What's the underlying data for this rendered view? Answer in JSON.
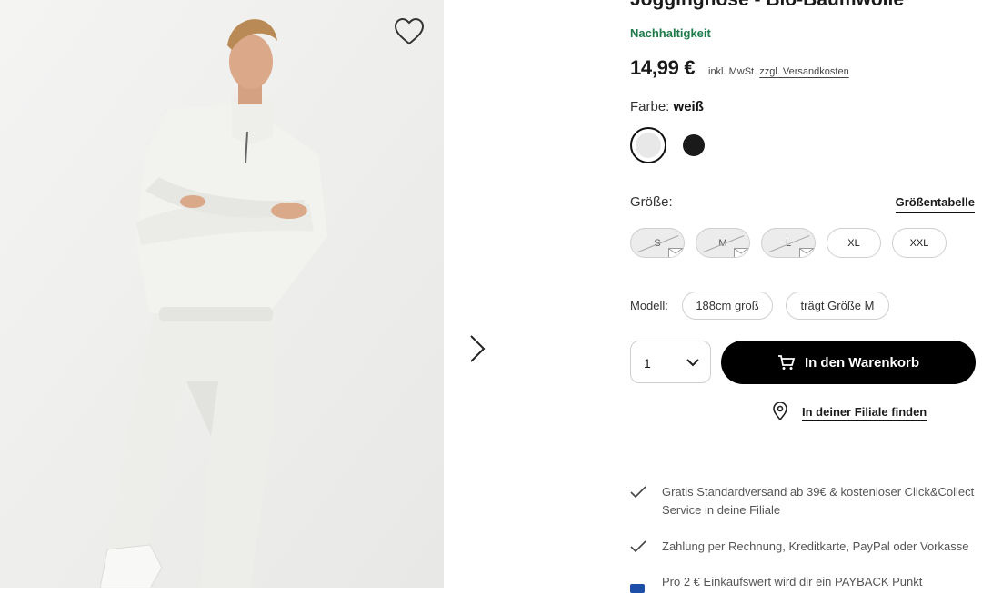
{
  "product": {
    "title": "Jogginghose - Bio-Baumwolle",
    "sustainability": "Nachhaltigkeit",
    "price": "14,99 €",
    "vat_text": "inkl. MwSt.",
    "shipping_link": "zzgl. Versandkosten"
  },
  "color": {
    "label": "Farbe:",
    "selected": "weiß",
    "swatches": [
      {
        "name": "weiß",
        "hex": "#e8e8e8",
        "selected": true
      },
      {
        "name": "schwarz",
        "hex": "#1a1a1a",
        "selected": false
      }
    ]
  },
  "size": {
    "label": "Größe:",
    "table_link": "Größentabelle",
    "options": [
      {
        "label": "S",
        "available": false
      },
      {
        "label": "M",
        "available": false
      },
      {
        "label": "L",
        "available": false
      },
      {
        "label": "XL",
        "available": true
      },
      {
        "label": "XXL",
        "available": true
      }
    ]
  },
  "model": {
    "label": "Modell:",
    "height": "188cm groß",
    "wears": "trägt Größe M"
  },
  "purchase": {
    "quantity": "1",
    "cart_button": "In den Warenkorb",
    "store_link": "In deiner Filiale finden"
  },
  "benefits": [
    "Gratis Standardversand ab 39€ & kostenloser Click&Collect Service in deine Filiale",
    "Zahlung per Rechnung, Kreditkarte, PayPal oder Vorkasse",
    "Pro 2 € Einkaufswert wird dir ein PAYBACK Punkt"
  ],
  "icons": {
    "wishlist": "heart-icon",
    "next": "chevron-right-icon",
    "cart": "cart-icon",
    "store": "location-pin-icon",
    "check": "check-icon"
  },
  "colors": {
    "sustainability_green": "#1f7a4a",
    "button_black": "#000000",
    "payback_blue": "#1d4fa8"
  }
}
